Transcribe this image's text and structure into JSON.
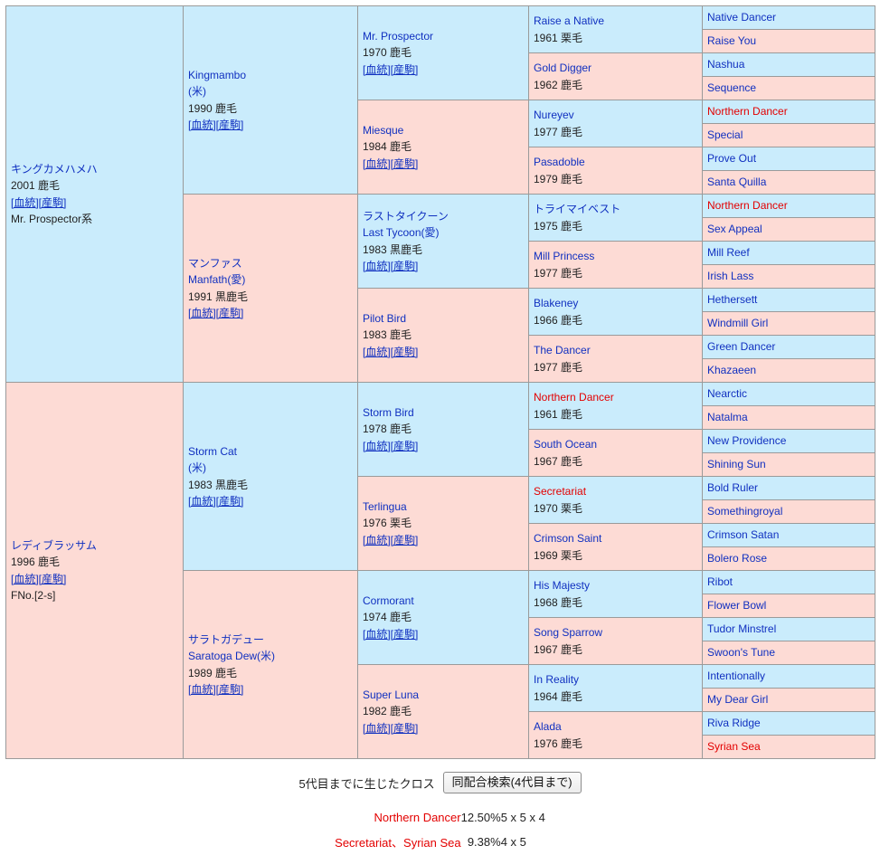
{
  "pedigree": {
    "gen1": {
      "name": "キングカメハメハ",
      "line2": "2001 鹿毛",
      "links": "[血統][産駒]",
      "family_line": "Mr. Prospector系",
      "tint": "blue"
    },
    "gen1b": {
      "name": "レディブラッサム",
      "line2": "1996 鹿毛",
      "links": "[血統][産駒]",
      "family_line": "FNo.[2-s]",
      "tint": "pink"
    },
    "gen2": [
      {
        "name": "Kingmambo",
        "country": "(米)",
        "line2": "1990 鹿毛",
        "links": "[血統][産駒]",
        "tint": "blue"
      },
      {
        "name": "マンファス",
        "country": "Manfath(愛)",
        "line2": "1991 黒鹿毛",
        "links": "[血統][産駒]",
        "tint": "pink"
      },
      {
        "name": "Storm Cat",
        "country": "(米)",
        "line2": "1983 黒鹿毛",
        "links": "[血統][産駒]",
        "tint": "blue"
      },
      {
        "name": "サラトガデュー",
        "country": "Saratoga Dew(米)",
        "line2": "1989 鹿毛",
        "links": "[血統][産駒]",
        "tint": "pink"
      }
    ],
    "gen3": [
      {
        "name": "Mr. Prospector",
        "country": "",
        "line2": "1970 鹿毛",
        "links": "[血統][産駒]",
        "tint": "blue"
      },
      {
        "name": "Miesque",
        "country": "",
        "line2": "1984 鹿毛",
        "links": "[血統][産駒]",
        "tint": "pink"
      },
      {
        "name": "ラストタイクーン",
        "country": "Last Tycoon(愛)",
        "line2": "1983 黒鹿毛",
        "links": "[血統][産駒]",
        "tint": "blue"
      },
      {
        "name": "Pilot Bird",
        "country": "",
        "line2": "1983 鹿毛",
        "links": "[血統][産駒]",
        "tint": "pink"
      },
      {
        "name": "Storm Bird",
        "country": "",
        "line2": "1978 鹿毛",
        "links": "[血統][産駒]",
        "tint": "blue"
      },
      {
        "name": "Terlingua",
        "country": "",
        "line2": "1976 栗毛",
        "links": "[血統][産駒]",
        "tint": "pink"
      },
      {
        "name": "Cormorant",
        "country": "",
        "line2": "1974 鹿毛",
        "links": "[血統][産駒]",
        "tint": "blue"
      },
      {
        "name": "Super Luna",
        "country": "",
        "line2": "1982 鹿毛",
        "links": "[血統][産駒]",
        "tint": "pink"
      }
    ],
    "gen4": [
      {
        "name": "Raise a Native",
        "line2": "1961 栗毛",
        "tint": "blue",
        "cross": false
      },
      {
        "name": "Gold Digger",
        "line2": "1962 鹿毛",
        "tint": "pink",
        "cross": false
      },
      {
        "name": "Nureyev",
        "line2": "1977 鹿毛",
        "tint": "blue",
        "cross": false
      },
      {
        "name": "Pasadoble",
        "line2": "1979 鹿毛",
        "tint": "pink",
        "cross": false
      },
      {
        "name": "トライマイベスト",
        "line2": "1975 鹿毛",
        "tint": "blue",
        "cross": false
      },
      {
        "name": "Mill Princess",
        "line2": "1977 鹿毛",
        "tint": "pink",
        "cross": false
      },
      {
        "name": "Blakeney",
        "line2": "1966 鹿毛",
        "tint": "blue",
        "cross": false
      },
      {
        "name": "The Dancer",
        "line2": "1977 鹿毛",
        "tint": "pink",
        "cross": false
      },
      {
        "name": "Northern Dancer",
        "line2": "1961 鹿毛",
        "tint": "blue",
        "cross": true
      },
      {
        "name": "South Ocean",
        "line2": "1967 鹿毛",
        "tint": "pink",
        "cross": false
      },
      {
        "name": "Secretariat",
        "line2": "1970 栗毛",
        "tint": "blue",
        "cross": true
      },
      {
        "name": "Crimson Saint",
        "line2": "1969 栗毛",
        "tint": "pink",
        "cross": false
      },
      {
        "name": "His Majesty",
        "line2": "1968 鹿毛",
        "tint": "blue",
        "cross": false
      },
      {
        "name": "Song Sparrow",
        "line2": "1967 鹿毛",
        "tint": "pink",
        "cross": false
      },
      {
        "name": "In Reality",
        "line2": "1964 鹿毛",
        "tint": "blue",
        "cross": false
      },
      {
        "name": "Alada",
        "line2": "1976 鹿毛",
        "tint": "pink",
        "cross": false
      }
    ],
    "gen5": [
      {
        "name": "Native Dancer",
        "tint": "blue",
        "cross": false
      },
      {
        "name": "Raise You",
        "tint": "pink",
        "cross": false
      },
      {
        "name": "Nashua",
        "tint": "blue",
        "cross": false
      },
      {
        "name": "Sequence",
        "tint": "pink",
        "cross": false
      },
      {
        "name": "Northern Dancer",
        "tint": "blue",
        "cross": true
      },
      {
        "name": "Special",
        "tint": "pink",
        "cross": false
      },
      {
        "name": "Prove Out",
        "tint": "blue",
        "cross": false
      },
      {
        "name": "Santa Quilla",
        "tint": "pink",
        "cross": false
      },
      {
        "name": "Northern Dancer",
        "tint": "blue",
        "cross": true
      },
      {
        "name": "Sex Appeal",
        "tint": "pink",
        "cross": false
      },
      {
        "name": "Mill Reef",
        "tint": "blue",
        "cross": false
      },
      {
        "name": "Irish Lass",
        "tint": "pink",
        "cross": false
      },
      {
        "name": "Hethersett",
        "tint": "blue",
        "cross": false
      },
      {
        "name": "Windmill Girl",
        "tint": "pink",
        "cross": false
      },
      {
        "name": "Green Dancer",
        "tint": "blue",
        "cross": false
      },
      {
        "name": "Khazaeen",
        "tint": "pink",
        "cross": false
      },
      {
        "name": "Nearctic",
        "tint": "blue",
        "cross": false
      },
      {
        "name": "Natalma",
        "tint": "pink",
        "cross": false
      },
      {
        "name": "New Providence",
        "tint": "blue",
        "cross": false
      },
      {
        "name": "Shining Sun",
        "tint": "pink",
        "cross": false
      },
      {
        "name": "Bold Ruler",
        "tint": "blue",
        "cross": false
      },
      {
        "name": "Somethingroyal",
        "tint": "pink",
        "cross": false
      },
      {
        "name": "Crimson Satan",
        "tint": "blue",
        "cross": false
      },
      {
        "name": "Bolero Rose",
        "tint": "pink",
        "cross": false
      },
      {
        "name": "Ribot",
        "tint": "blue",
        "cross": false
      },
      {
        "name": "Flower Bowl",
        "tint": "pink",
        "cross": false
      },
      {
        "name": "Tudor Minstrel",
        "tint": "blue",
        "cross": false
      },
      {
        "name": "Swoon's Tune",
        "tint": "pink",
        "cross": false
      },
      {
        "name": "Intentionally",
        "tint": "blue",
        "cross": false
      },
      {
        "name": "My Dear Girl",
        "tint": "pink",
        "cross": false
      },
      {
        "name": "Riva Ridge",
        "tint": "blue",
        "cross": false
      },
      {
        "name": "Syrian Sea",
        "tint": "pink",
        "cross": true
      }
    ]
  },
  "footer": {
    "cross_label": "5代目までに生じたクロス",
    "same_mating_button": "同配合検索(4代目まで)",
    "crosses": [
      {
        "name": "Northern Dancer",
        "percent": "12.50%",
        "generations": "5 x 5 x 4"
      },
      {
        "name": "Secretariat、Syrian Sea",
        "percent": "9.38%",
        "generations": "4 x 5"
      }
    ]
  },
  "colors": {
    "sire_tint": "#caecfc",
    "dam_tint": "#fddbd5",
    "link_blue": "#1030c0",
    "cross_red": "#e30000",
    "border": "#9a9a9a"
  }
}
